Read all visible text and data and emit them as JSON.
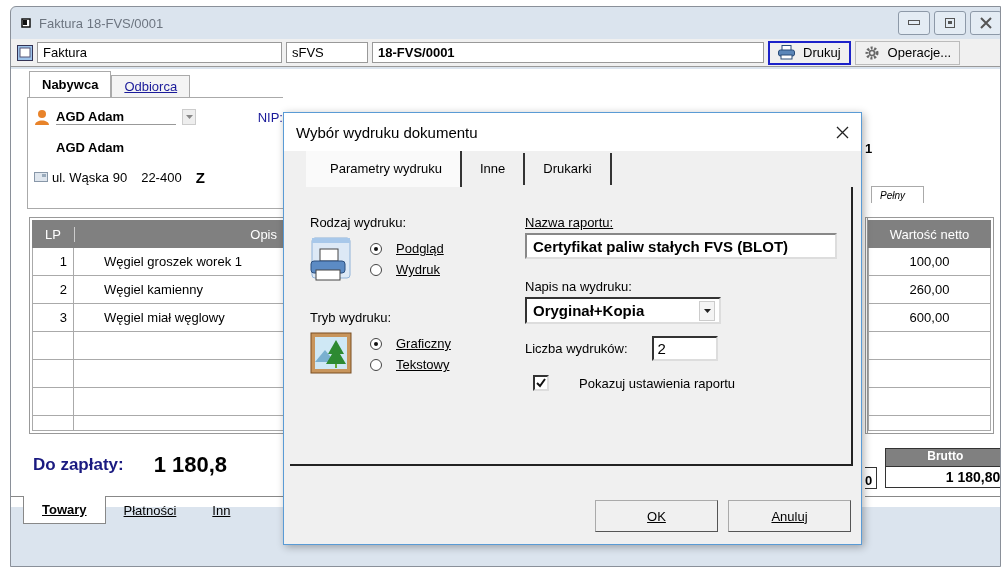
{
  "window": {
    "title": "Faktura 18-FVS/0001"
  },
  "toolbar": {
    "document_type": "Faktura",
    "series": "sFVS",
    "number": "18-FVS/0001",
    "print_button": "Drukuj",
    "operations_button": "Operacje..."
  },
  "party_tabs": [
    {
      "label": "Nabywca",
      "selected": true
    },
    {
      "label": "Odbiorca",
      "selected": false
    }
  ],
  "customer": {
    "name": "AGD Adam",
    "nip_label": "NIP:",
    "full_name": "AGD Adam",
    "street": "ul. Wąska 90",
    "postal_code": "22-400",
    "city": "Z",
    "right_fragment": "1"
  },
  "view_tab": "Pełny",
  "table": {
    "columns": [
      "LP",
      "Opis",
      "Wartość netto"
    ],
    "rows": [
      {
        "lp": "1",
        "opis": "Węgiel groszek worek 1",
        "netto": "100,00"
      },
      {
        "lp": "2",
        "opis": "Węgiel kamienny",
        "netto": "260,00"
      },
      {
        "lp": "3",
        "opis": "Węgiel miał węglowy",
        "netto": "600,00"
      }
    ]
  },
  "totals": {
    "label": "Do zapłaty:",
    "amount": "1 180,8",
    "column_3_value": "0",
    "gross_label": "Brutto",
    "gross_value": "1 180,80"
  },
  "bottom_tabs": [
    {
      "label": "Towary",
      "selected": true
    },
    {
      "label": "Płatności",
      "selected": false
    },
    {
      "label": "Inn",
      "selected": false
    }
  ],
  "dialog": {
    "title": "Wybór wydruku dokumentu",
    "tabs": [
      {
        "label": "Parametry wydruku",
        "selected": true
      },
      {
        "label": "Inne",
        "selected": false
      },
      {
        "label": "Drukarki",
        "selected": false
      }
    ],
    "print_type": {
      "label": "Rodzaj wydruku:",
      "options": [
        {
          "label": "Podgląd",
          "selected": true
        },
        {
          "label": "Wydruk",
          "selected": false
        }
      ]
    },
    "print_mode": {
      "label": "Tryb wydruku:",
      "options": [
        {
          "label": "Graficzny",
          "selected": true
        },
        {
          "label": "Tekstowy",
          "selected": false
        }
      ]
    },
    "report_name_label": "Nazwa raportu:",
    "report_name": "Certyfikat paliw stałych FVS (BLOT)",
    "caption_label": "Napis na wydruku:",
    "caption": "Oryginał+Kopia",
    "copies_label": "Liczba wydruków:",
    "copies": "2",
    "show_settings": {
      "label": "Pokazuj ustawienia raportu",
      "checked": true
    },
    "buttons": [
      "OK",
      "Anuluj"
    ]
  }
}
